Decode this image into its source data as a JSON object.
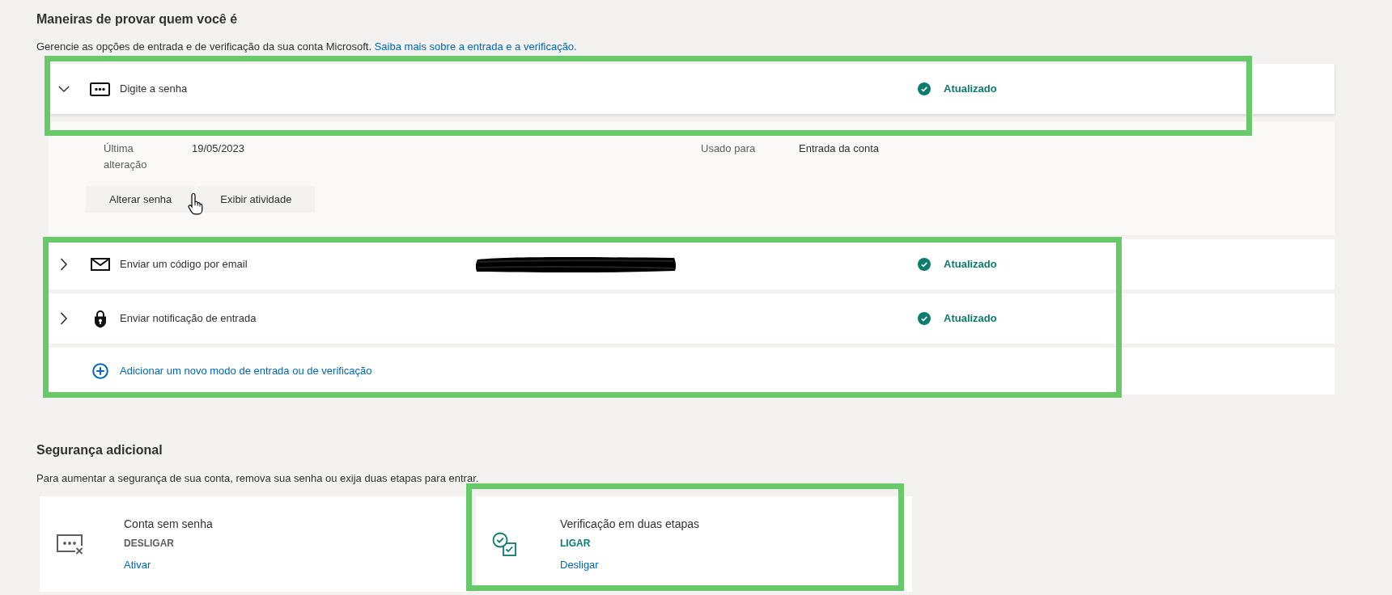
{
  "sign_in_methods": {
    "title": "Maneiras de provar quem você é",
    "description": "Gerencie as opções de entrada e de verificação da sua conta Microsoft.",
    "learn_more_link": "Saiba mais sobre a entrada e a verificação.",
    "methods": [
      {
        "kind": "password",
        "label": "Digite a senha",
        "status": "Atualizado",
        "expanded": true,
        "highlighted": true,
        "redacted": false,
        "details": {
          "fields": [
            {
              "label": "Última alteração",
              "value": "19/05/2023"
            },
            {
              "label": "Usado para",
              "value": "Entrada da conta"
            }
          ],
          "actions": [
            "Alterar senha",
            "Exibir atividade"
          ]
        }
      },
      {
        "kind": "email",
        "label": "Enviar um código por email",
        "status": "Atualizado",
        "expanded": false,
        "highlighted": true,
        "redacted": true
      },
      {
        "kind": "notification",
        "label": "Enviar notificação de entrada",
        "status": "Atualizado",
        "expanded": false,
        "highlighted": true,
        "redacted": false
      }
    ],
    "add_method": {
      "label": "Adicionar um novo modo de entrada ou de verificação",
      "highlighted": true
    }
  },
  "extra_security": {
    "title": "Segurança adicional",
    "description": "Para aumentar a segurança de sua conta, remova sua senha ou exija duas etapas para entrar.",
    "options": [
      {
        "kind": "passwordless",
        "title": "Conta sem senha",
        "state_label": "DESLIGAR",
        "on": false,
        "action": "Ativar",
        "highlighted": false
      },
      {
        "kind": "two_step",
        "title": "Verificação em duas etapas",
        "state_label": "LIGAR",
        "on": true,
        "action": "Desligar",
        "highlighted": true
      }
    ]
  }
}
